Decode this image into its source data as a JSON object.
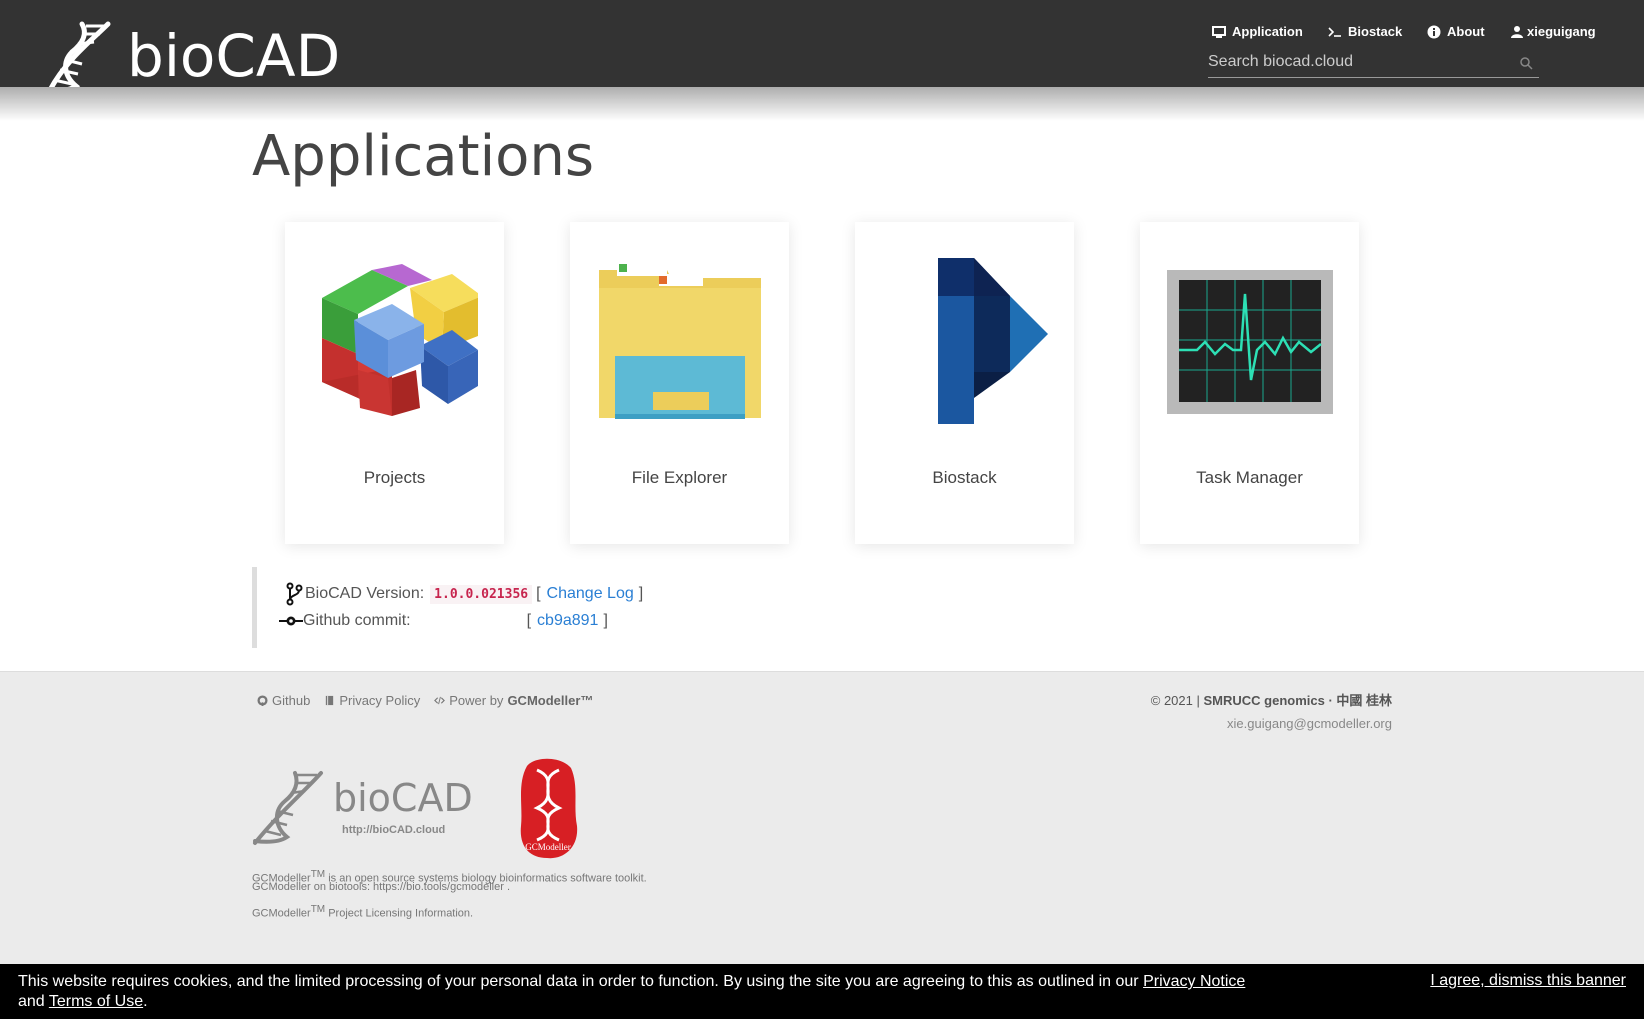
{
  "header": {
    "logo_text": "bioCAD",
    "nav": [
      {
        "label": "Application",
        "icon": "monitor-icon"
      },
      {
        "label": "Biostack",
        "icon": "terminal-icon"
      },
      {
        "label": "About",
        "icon": "info-icon"
      },
      {
        "label": "xieguigang",
        "icon": "user-icon"
      }
    ],
    "search_placeholder": "Search biocad.cloud"
  },
  "main": {
    "title": "Applications",
    "apps": [
      {
        "label": "Projects",
        "icon": "cubes-icon"
      },
      {
        "label": "File Explorer",
        "icon": "folder-icon"
      },
      {
        "label": "Biostack",
        "icon": "biostack-icon"
      },
      {
        "label": "Task Manager",
        "icon": "task-manager-icon"
      }
    ],
    "version": {
      "version_label": "BioCAD Version:",
      "version_value": "1.0.0.021356",
      "changelog_open": "[",
      "changelog_label": "Change Log",
      "changelog_close": "]",
      "commit_label": "Github commit:",
      "commit_open": "[",
      "commit_value": "cb9a891",
      "commit_close": "]"
    }
  },
  "footer": {
    "links": [
      {
        "label": "Github",
        "icon": "github-icon"
      },
      {
        "label": "Privacy Policy",
        "icon": "book-icon"
      },
      {
        "label": "Power by",
        "bold": "GCModeller™",
        "icon": "code-icon"
      }
    ],
    "copyright_prefix": "© 2021 |",
    "copyright_org": "SMRUCC genomics · 中國 桂林",
    "email": "xie.guigang@gcmodeller.org",
    "logo_text": "bioCAD",
    "logo_url": "http://bioCAD.cloud",
    "seal_text": "GCModeller",
    "note1_a": "GCModeller",
    "note1_sup": "TM",
    "note1_b": " is an open source systems biology bioinformatics software toolkit.",
    "note2": "GCModeller on biotools: https://bio.tools/gcmodeller .",
    "note3_a": "GCModeller",
    "note3_sup": "TM",
    "note3_b": " Project Licensing Information."
  },
  "cookie": {
    "message_a": "This website requires cookies, and the limited processing of your personal data in order to function. By using the site you are agreeing to this as outlined in our ",
    "privacy_link": "Privacy Notice",
    "message_b": " and ",
    "terms_link": "Terms of Use",
    "message_c": ".",
    "dismiss": "I agree, dismiss this banner"
  }
}
